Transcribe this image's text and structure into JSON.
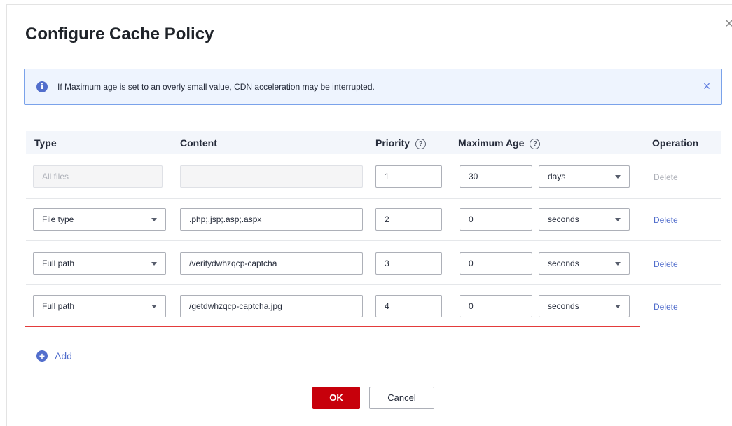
{
  "dialog": {
    "title": "Configure Cache Policy",
    "close_icon": "close-icon"
  },
  "alert": {
    "text": "If Maximum age is set to an overly small value, CDN acceleration may be interrupted.",
    "icon": "info-icon",
    "close_icon": "close-icon"
  },
  "table": {
    "headers": {
      "type": "Type",
      "content": "Content",
      "priority": "Priority",
      "max_age": "Maximum Age",
      "operation": "Operation",
      "help": "?"
    },
    "rows": [
      {
        "type": "All files",
        "content": "",
        "priority": "1",
        "age": "30",
        "unit": "days",
        "op": "Delete"
      },
      {
        "type": "File type",
        "content": ".php;.jsp;.asp;.aspx",
        "priority": "2",
        "age": "0",
        "unit": "seconds",
        "op": "Delete"
      },
      {
        "type": "Full path",
        "content": "/verifydwhzqcp-captcha",
        "priority": "3",
        "age": "0",
        "unit": "seconds",
        "op": "Delete"
      },
      {
        "type": "Full path",
        "content": "/getdwhzqcp-captcha.jpg",
        "priority": "4",
        "age": "0",
        "unit": "seconds",
        "op": "Delete"
      }
    ]
  },
  "add": {
    "label": "Add",
    "icon": "plus-circle-icon"
  },
  "buttons": {
    "ok": "OK",
    "cancel": "Cancel"
  },
  "colors": {
    "accent": "#526ecc",
    "primary_button": "#c7000b",
    "highlight_border": "#e33b3b"
  }
}
